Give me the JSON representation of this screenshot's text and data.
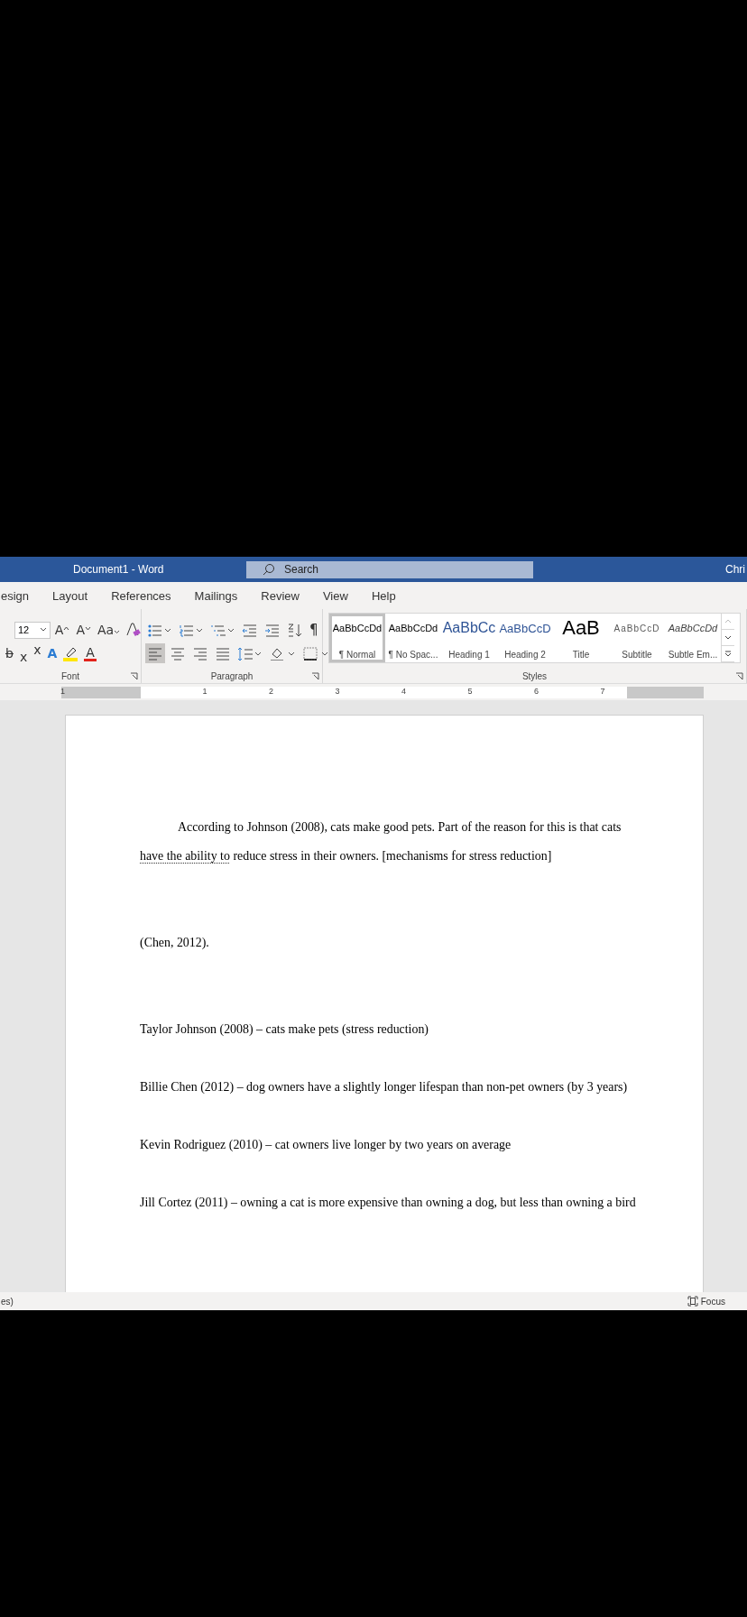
{
  "window": {
    "title": "Document1  -  Word",
    "search": {
      "placeholder": "Search"
    },
    "user": "Chri"
  },
  "tabs": [
    {
      "label": "esign"
    },
    {
      "label": "Layout"
    },
    {
      "label": "References"
    },
    {
      "label": "Mailings"
    },
    {
      "label": "Review"
    },
    {
      "label": "View"
    },
    {
      "label": "Help"
    }
  ],
  "ribbon": {
    "font": {
      "label": "Font",
      "font_size": "12",
      "row1": [
        {
          "kind": "grow",
          "glyph": "A"
        },
        {
          "kind": "shrink",
          "glyph": "A"
        },
        {
          "kind": "case",
          "glyph": "Aa"
        }
      ],
      "row2": [
        {
          "kind": "strike",
          "glyph": "b"
        },
        {
          "kind": "sub",
          "glyph": "x"
        },
        {
          "kind": "sup",
          "glyph": "x"
        },
        {
          "kind": "effects",
          "glyph": "A"
        },
        {
          "kind": "highlight"
        },
        {
          "kind": "color",
          "glyph": "A"
        }
      ]
    },
    "paragraph": {
      "label": "Paragraph",
      "pilcrow": "¶",
      "alignments": [
        {
          "kind": "left",
          "selected": true
        },
        {
          "kind": "center",
          "selected": false
        },
        {
          "kind": "right",
          "selected": false
        },
        {
          "kind": "justify",
          "selected": false
        }
      ]
    },
    "styles": {
      "label": "Styles",
      "items": [
        {
          "kind": "normal",
          "preview": "AaBbCcDd",
          "name": "¶ Normal",
          "selected": true
        },
        {
          "kind": "nospacing",
          "preview": "AaBbCcDd",
          "name": "¶ No Spac...",
          "selected": false
        },
        {
          "kind": "heading1",
          "preview": "AaBbCc",
          "name": "Heading 1",
          "selected": false
        },
        {
          "kind": "heading2",
          "preview": "AaBbCcD",
          "name": "Heading 2",
          "selected": false
        },
        {
          "kind": "title",
          "preview": "AaB",
          "name": "Title",
          "selected": false
        },
        {
          "kind": "subtitle",
          "preview": "AaBbCcD",
          "name": "Subtitle",
          "selected": false
        },
        {
          "kind": "emphasis",
          "preview": "AaBbCcDd",
          "name": "Subtle Em...",
          "selected": false
        }
      ]
    }
  },
  "ruler": {
    "labels": [
      "1",
      "1",
      "2",
      "3",
      "4",
      "5",
      "6",
      "7"
    ]
  },
  "document": {
    "paragraphs": [
      {
        "kind": "intro",
        "segments": [
          {
            "text": "According to Johnson (2008), cats make good pets. Part of the reason for this is that cats ",
            "flagged": false
          },
          {
            "text": "have the ability to",
            "flagged": true
          },
          {
            "text": " reduce stress in their owners. [mechanisms for stress reduction]",
            "flagged": false
          }
        ]
      },
      {
        "kind": "citation",
        "segments": [
          {
            "text": "(Chen, 2012).",
            "flagged": false
          }
        ]
      },
      {
        "kind": "source",
        "segments": [
          {
            "text": "Taylor Johnson (2008) – cats make pets (stress reduction)",
            "flagged": false
          }
        ]
      },
      {
        "kind": "source",
        "segments": [
          {
            "text": "Billie Chen (2012) – dog owners have a slightly longer lifespan than non-pet owners (by 3 years)",
            "flagged": false
          }
        ]
      },
      {
        "kind": "source",
        "segments": [
          {
            "text": "Kevin Rodriguez (2010) – cat owners live longer by two years on average",
            "flagged": false
          }
        ]
      },
      {
        "kind": "source",
        "segments": [
          {
            "text": "Jill Cortez (2011) – owning a cat is more expensive than owning a dog, but less than owning a bird",
            "flagged": false
          }
        ]
      }
    ]
  },
  "status_bar": {
    "left": "es)",
    "focus": "Focus"
  }
}
